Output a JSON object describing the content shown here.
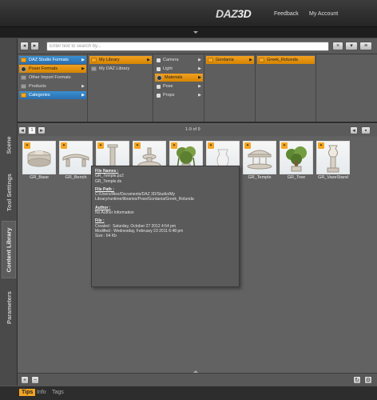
{
  "header": {
    "logo_text": "DAZ",
    "logo_suffix": "3D",
    "feedback": "Feedback",
    "my_account": "My Account"
  },
  "side_tabs": [
    "Scene",
    "Tool Settings",
    "Content Library",
    "Parameters"
  ],
  "side_tab_active": "Content Library",
  "search": {
    "placeholder": "Enter text to search by..."
  },
  "browser": {
    "col1": [
      {
        "label": "DAZ Studio Formats",
        "state": "selected-blue",
        "arrow": "▶"
      },
      {
        "label": "Poser Formats",
        "state": "selected-orange",
        "arrow": "▶"
      },
      {
        "label": "Other Import Formats",
        "state": "normal",
        "arrow": ""
      },
      {
        "label": "Products",
        "state": "normal",
        "arrow": "▶"
      },
      {
        "label": "Categories",
        "state": "selected-blue",
        "arrow": "▶"
      }
    ],
    "col2": [
      {
        "label": "My Library",
        "state": "selected-orange",
        "arrow": "▶"
      },
      {
        "label": "My DAZ Library",
        "state": "normal",
        "arrow": ""
      }
    ],
    "col3": [
      {
        "label": "Camera",
        "state": "normal",
        "arrow": "▶"
      },
      {
        "label": "Light",
        "state": "normal",
        "arrow": "▶"
      },
      {
        "label": "Materials",
        "state": "selected-orange",
        "arrow": "▶"
      },
      {
        "label": "Pose",
        "state": "normal",
        "arrow": "▶"
      },
      {
        "label": "Props",
        "state": "normal",
        "arrow": "▶"
      }
    ],
    "col4": [
      {
        "label": "Gordania",
        "state": "selected-orange",
        "arrow": "▶"
      }
    ],
    "col5": [
      {
        "label": "Greek_Rotunda",
        "state": "selected-orange",
        "arrow": ""
      }
    ]
  },
  "pager": {
    "page": "1",
    "count_text": "1-9 of 9"
  },
  "thumbnails": [
    {
      "label": "GR_Base",
      "art": "base"
    },
    {
      "label": "GR_Bench",
      "art": "bench"
    },
    {
      "label": "",
      "art": "column"
    },
    {
      "label": "",
      "art": "fountain"
    },
    {
      "label": "",
      "art": "plant"
    },
    {
      "label": "",
      "art": "vase"
    },
    {
      "label": "GR_Temple",
      "art": "temple"
    },
    {
      "label": "GR_Tree",
      "art": "tree"
    },
    {
      "label": "GR_VaseStand",
      "art": "vasestand"
    }
  ],
  "tooltip": {
    "file_names_h": "File Names :",
    "file_names": [
      "GR_Temple.pz2",
      "GR_Temple.ds"
    ],
    "file_path_h": "File Path :",
    "file_path": [
      "C:/Users/Alex/Documents/DAZ 3D/Studio/My",
      "Library/runtime/libraries/Pose/Gordania/Greek_Rotunda"
    ],
    "author_h": "Author :",
    "author": "No Author Information",
    "file_h": "File :",
    "file_lines": [
      "Created :  Saturday, October 27 2012 4:54 pm",
      "Modified :  Wednesday, February 23 2011 6:48 pm",
      "Size :       64 Kb"
    ]
  },
  "bottom_tabs": [
    "Tips",
    "Info",
    "Tags"
  ],
  "bottom_tab_active": "Tips",
  "colors": {
    "accent_orange": "#f5a623",
    "select_blue": "#2a7fc4",
    "panel_grey": "#606060"
  }
}
